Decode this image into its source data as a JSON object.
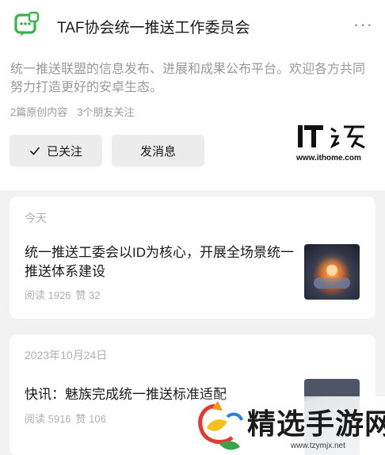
{
  "account": {
    "name": "TAF协会统一推送工作委员会",
    "description": "统一推送联盟的信息发布、进展和成果公布平台。欢迎各方共同努力打造更好的安卓生态。",
    "original_count": "2篇原创内容",
    "friends_following": "3个朋友关注"
  },
  "actions": {
    "follow_label": "已关注",
    "message_label": "发消息"
  },
  "articles": [
    {
      "date": "今天",
      "title": "统一推送工委会以ID为核心，开展全场景统一推送体系建设",
      "reads": "阅读 1926",
      "likes": "赞 32"
    },
    {
      "date": "2023年10月24日",
      "title": "快讯：魅族完成统一推送标准适配",
      "reads": "阅读 5916",
      "likes": "赞 106"
    }
  ],
  "watermarks": {
    "ithome_url": "www.ithome.com",
    "site_title": "精选手游网",
    "site_url": "www.tzymjx.net"
  },
  "icons": {
    "logo": "chat-bubble-logo-icon",
    "more": "more-dots-icon",
    "follow": "check-icon"
  },
  "colors": {
    "logo_green": "#3ab54a",
    "page_bg": "#f2f2f2",
    "button_bg": "#ececec",
    "meta_text": "#9a9a9a"
  }
}
